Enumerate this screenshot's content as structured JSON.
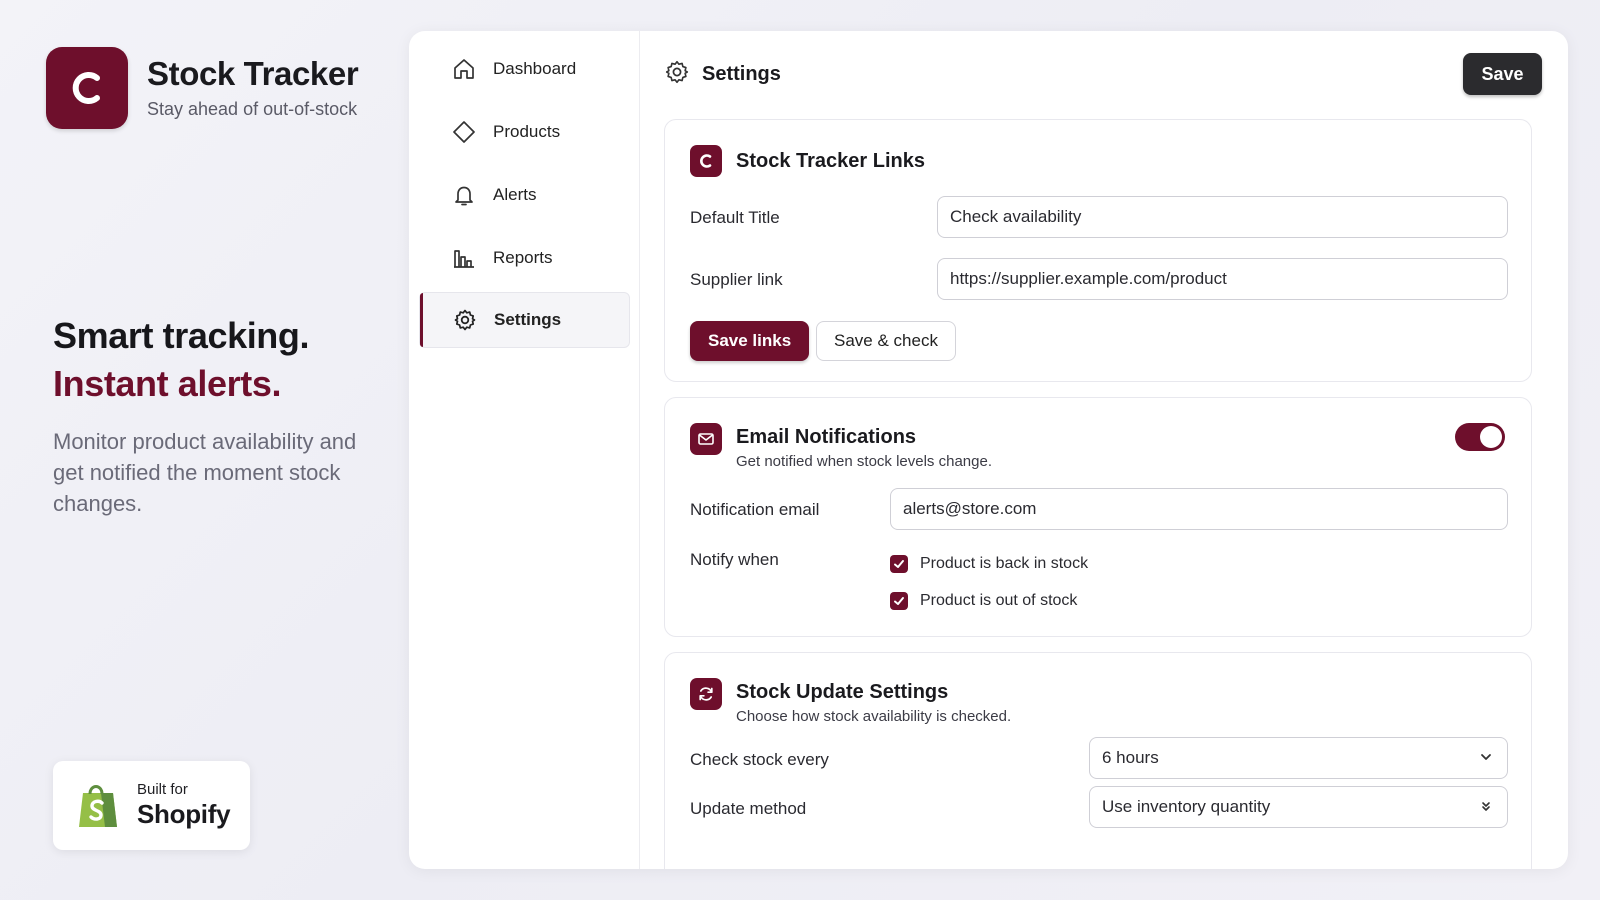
{
  "brand": {
    "logo_letter": "C",
    "title": "Stock Tracker",
    "subtitle": "Stay ahead of out-of-stock"
  },
  "hero": {
    "line1": "Smart tracking.",
    "line2": "Instant alerts.",
    "description": "Monitor product availability and get notified the moment stock changes."
  },
  "badge": {
    "small": "Built for",
    "big": "Shopify"
  },
  "nav": {
    "items": [
      {
        "label": "Dashboard",
        "icon": "home-icon"
      },
      {
        "label": "Products",
        "icon": "tag-icon"
      },
      {
        "label": "Alerts",
        "icon": "bell-icon"
      },
      {
        "label": "Reports",
        "icon": "bar-chart-icon"
      },
      {
        "label": "Settings",
        "icon": "gear-icon",
        "active": true
      }
    ]
  },
  "header": {
    "title": "Settings",
    "save_label": "Save"
  },
  "links_card": {
    "title": "Stock Tracker Links",
    "default_title_label": "Default Title",
    "default_title_value": "Check availability",
    "supplier_label": "Supplier link",
    "supplier_value": "https://supplier.example.com/product",
    "save_links_label": "Save links",
    "save_check_label": "Save & check"
  },
  "email_card": {
    "title": "Email Notifications",
    "description": "Get notified when stock levels change.",
    "enabled": true,
    "email_label": "Notification email",
    "email_value": "alerts@store.com",
    "notify_label": "Notify when",
    "options": [
      {
        "label": "Product is back in stock",
        "checked": true
      },
      {
        "label": "Product is out of stock",
        "checked": true
      }
    ]
  },
  "update_card": {
    "title": "Stock Update Settings",
    "description": "Choose how stock availability is checked.",
    "frequency_label": "Check stock every",
    "frequency_value": "6 hours",
    "method_label": "Update method",
    "method_value": "Use inventory quantity"
  },
  "colors": {
    "brand": "#6e0f2c",
    "dark_button": "#2b2b2e"
  }
}
